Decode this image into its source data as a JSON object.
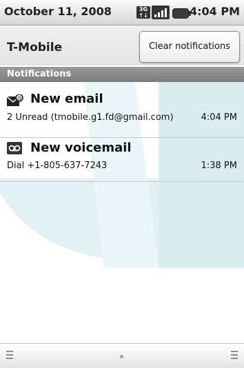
{
  "status_bar": {
    "date": "October 11, 2008",
    "time": "4:04 PM",
    "icons": [
      "3g-icon",
      "signal-icon",
      "battery-icon"
    ]
  },
  "header": {
    "carrier": "T-Mobile",
    "clear_button_label": "Clear notifications"
  },
  "section": {
    "label": "Notifications"
  },
  "notifications": [
    {
      "icon": "email-icon",
      "title": "New email",
      "subtitle": "2 Unread (tmobile.g1.fd@gmail.com)",
      "time": "4:04 PM"
    },
    {
      "icon": "voicemail-icon",
      "title": "New voicemail",
      "subtitle": "Dial +1-805-637-7243",
      "time": "1:38 PM"
    }
  ],
  "colors": {
    "watermark": "#dbeff2",
    "section_bg": "#8a8a8a",
    "background": "#ffffff"
  }
}
